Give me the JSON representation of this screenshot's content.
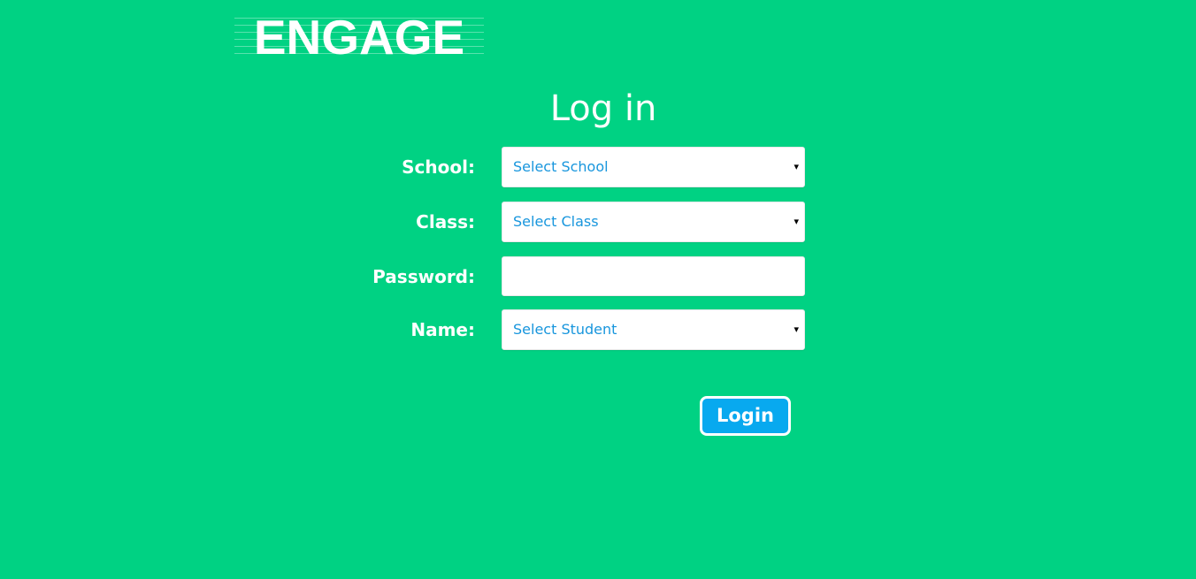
{
  "logo": {
    "text": "ENGAGE"
  },
  "title": "Log in",
  "form": {
    "school": {
      "label": "School:",
      "value": "Select School"
    },
    "class": {
      "label": "Class:",
      "value": "Select Class"
    },
    "password": {
      "label": "Password:",
      "value": ""
    },
    "name": {
      "label": "Name:",
      "value": "Select Student"
    }
  },
  "login_button": {
    "label": "Login"
  },
  "icons": {
    "dropdown_caret": "▾"
  },
  "colors": {
    "background": "#00d283",
    "button": "#08a9ef",
    "field_text": "#1896dd"
  }
}
